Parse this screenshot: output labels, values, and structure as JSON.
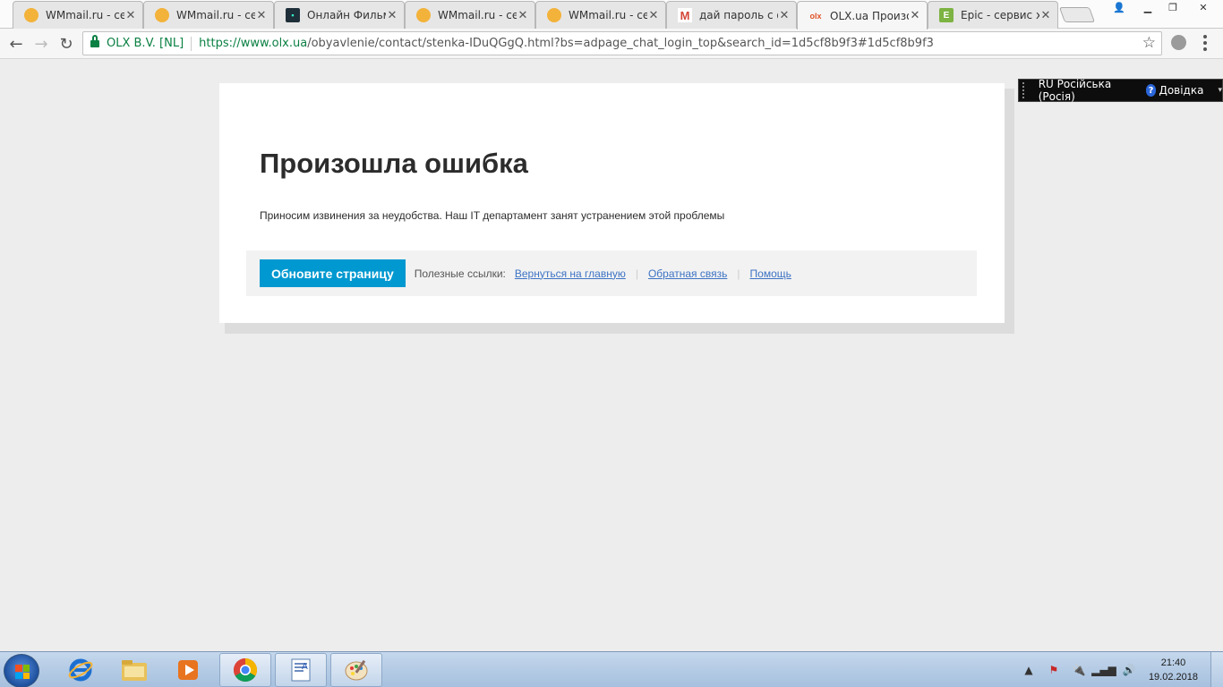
{
  "browser": {
    "tabs": [
      {
        "title": "WMmail.ru - сер",
        "icon": "wmmail-favicon",
        "active": false
      },
      {
        "title": "WMmail.ru - сер",
        "icon": "wmmail-favicon",
        "active": false
      },
      {
        "title": "Онлайн Фильмы",
        "icon": "tv-favicon",
        "active": false
      },
      {
        "title": "WMmail.ru - сер",
        "icon": "wmmail-favicon",
        "active": false
      },
      {
        "title": "WMmail.ru - сер",
        "icon": "wmmail-favicon",
        "active": false
      },
      {
        "title": "дай пароль с ф",
        "icon": "gmail-favicon",
        "active": false
      },
      {
        "title": "OLX.ua Произо",
        "icon": "olx-favicon",
        "active": true
      },
      {
        "title": "Epic - сервис хр",
        "icon": "epic-favicon",
        "active": false
      }
    ],
    "address": {
      "site_identity": "OLX B.V. [NL]",
      "url_scheme": "https://",
      "url_host": "www.olx.ua",
      "url_path": "/obyavlenie/contact/stenka-IDuQGgQ.html?bs=adpage_chat_login_top&search_id=1d5cf8b9f3#1d5cf8b9f3"
    }
  },
  "langbar": {
    "language": "RU Російська (Росія)",
    "help": "Довідка"
  },
  "page": {
    "title": "Произошла ошибка",
    "description": "Приносим извинения за неудобства. Наш IT департамент занят устранением этой проблемы",
    "refresh_button": "Обновите страницу",
    "useful_links_label": "Полезные ссылки:",
    "links": [
      "Вернуться на главную",
      "Обратная связь",
      "Помощь"
    ]
  },
  "taskbar": {
    "time": "21:40",
    "date": "19.02.2018"
  },
  "colors": {
    "accent_button": "#0098d0",
    "link": "#3d73c4",
    "secure_green": "#0b8043"
  }
}
